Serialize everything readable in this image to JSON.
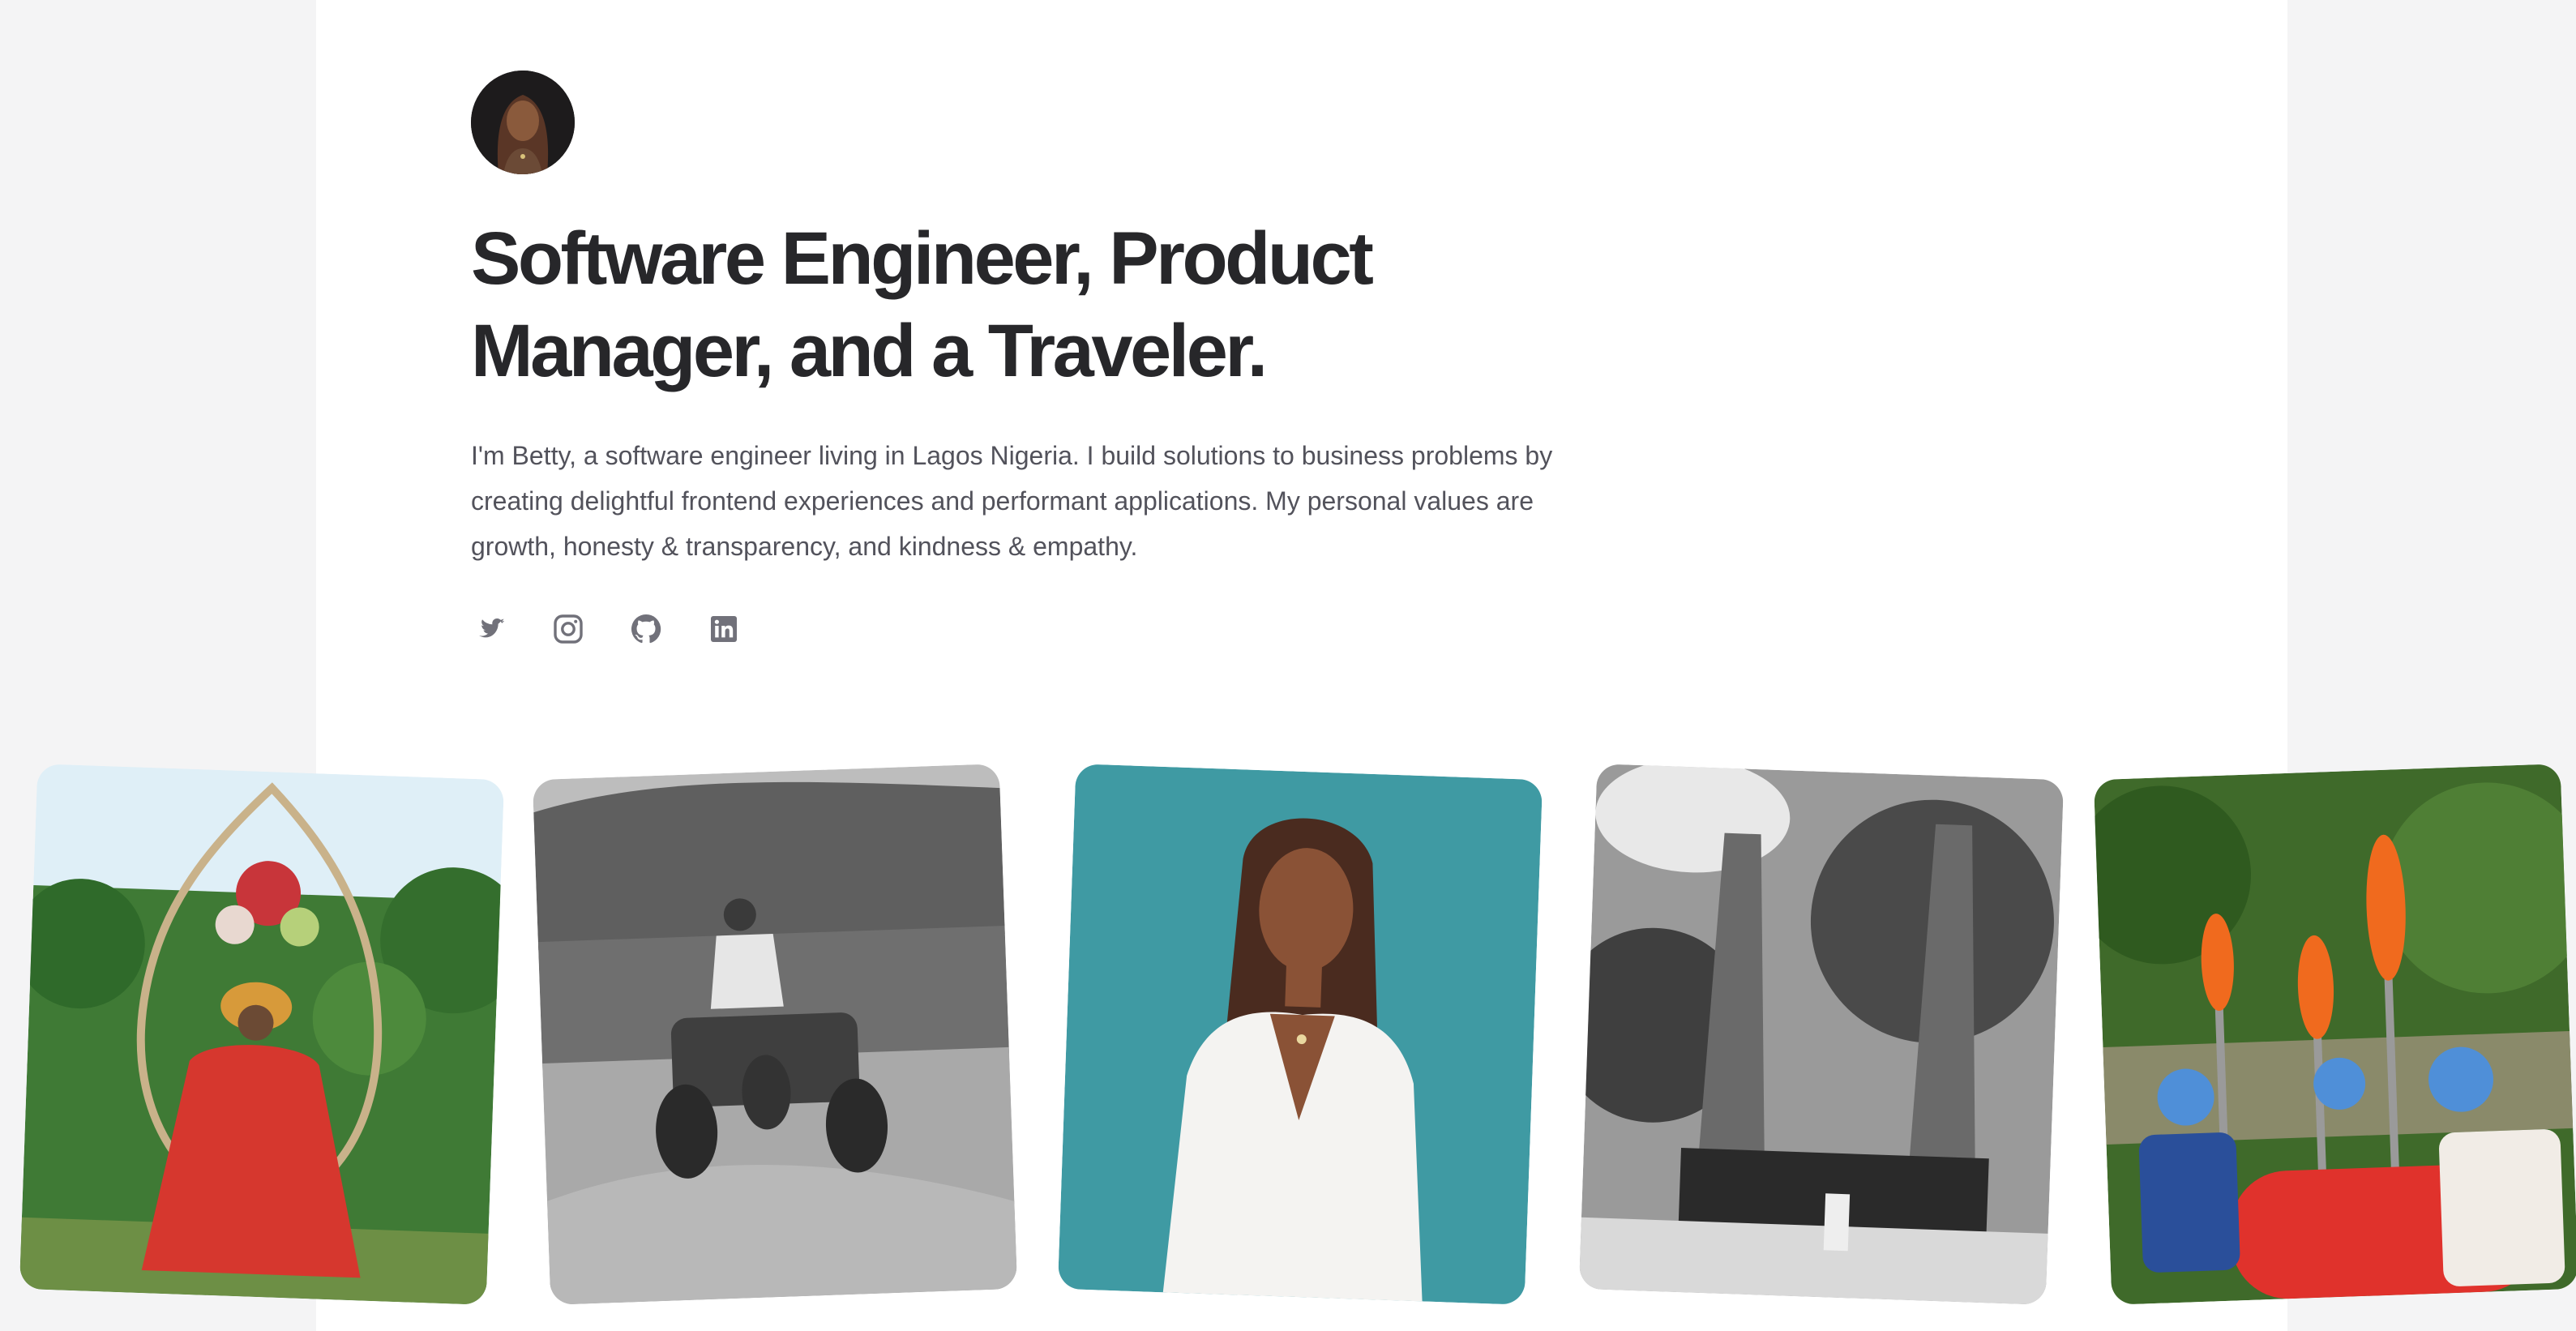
{
  "hero": {
    "avatar_icon": "profile-photo",
    "title": "Software Engineer, Product Manager, and a Traveler.",
    "intro": "I'm Betty, a software engineer living in Lagos Nigeria. I build solutions to business problems by creating delightful frontend experiences and performant applications. My personal values are growth, honesty & transparency, and kindness & empathy."
  },
  "socials": [
    {
      "icon": "twitter-icon"
    },
    {
      "icon": "instagram-icon"
    },
    {
      "icon": "github-icon"
    },
    {
      "icon": "linkedin-icon"
    }
  ],
  "photos": [
    {
      "subject": "woman in red dress on flower swing in jungle"
    },
    {
      "subject": "woman riding quad bike, black and white"
    },
    {
      "subject": "portrait of woman in white blazer on teal background"
    },
    {
      "subject": "temple gate, black and white"
    },
    {
      "subject": "white water rafting group"
    }
  ],
  "colors": {
    "page_background": "#f4f4f5",
    "panel_background": "#ffffff",
    "heading": "#27272a",
    "body_text": "#52525b",
    "icon": "#71717a"
  }
}
